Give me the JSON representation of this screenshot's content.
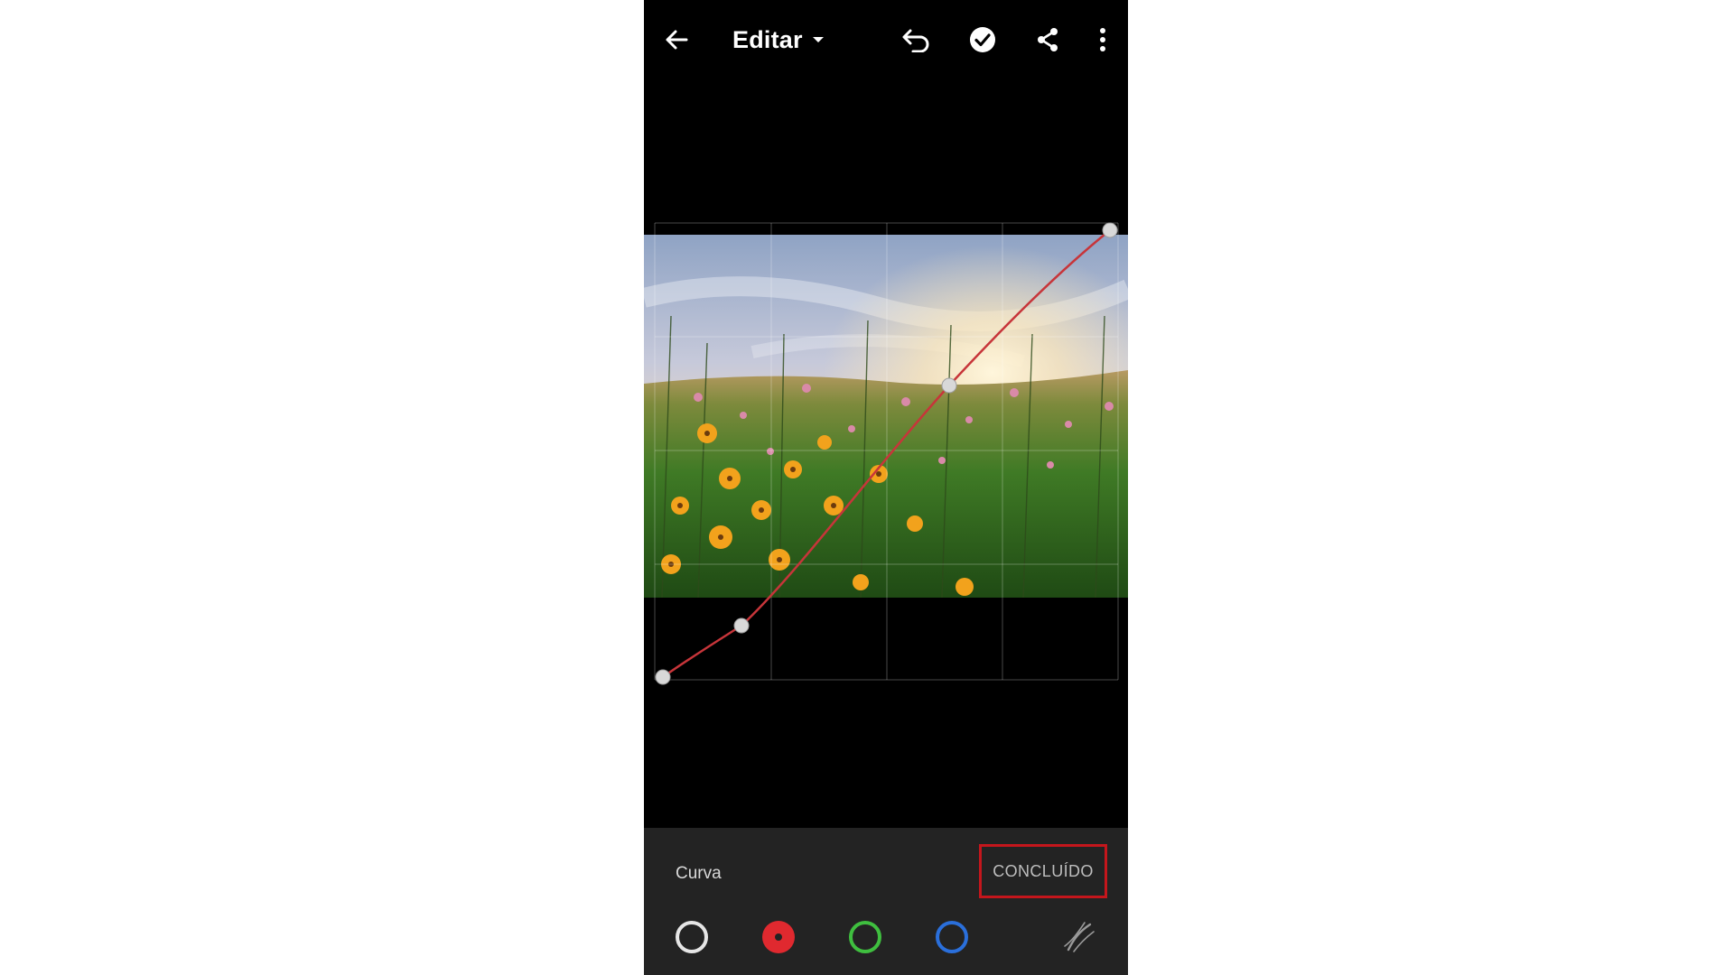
{
  "app": {
    "header": {
      "title": "Editar",
      "icons": [
        "back-arrow-icon",
        "dropdown-caret-icon",
        "undo-icon",
        "checkmark-circle-icon",
        "share-icon",
        "more-vertical-icon"
      ]
    },
    "photo": {
      "subject": "meadow with yellow and pink wildflowers at sunset"
    },
    "curve": {
      "line_color": "#c7353a",
      "point_color": "#d8d8d8"
    },
    "panel": {
      "label": "Curva",
      "done_label": "CONCLUÍDO",
      "highlight_color": "#c4161c",
      "channels": [
        {
          "name": "luminance",
          "color": "#e6e6e6",
          "selected": false
        },
        {
          "name": "red",
          "color": "#e0292f",
          "selected": true
        },
        {
          "name": "green",
          "color": "#3fbf3f",
          "selected": false
        },
        {
          "name": "blue",
          "color": "#2a6fdb",
          "selected": false
        }
      ],
      "parametric_icon": "parametric-curve-icon"
    }
  }
}
